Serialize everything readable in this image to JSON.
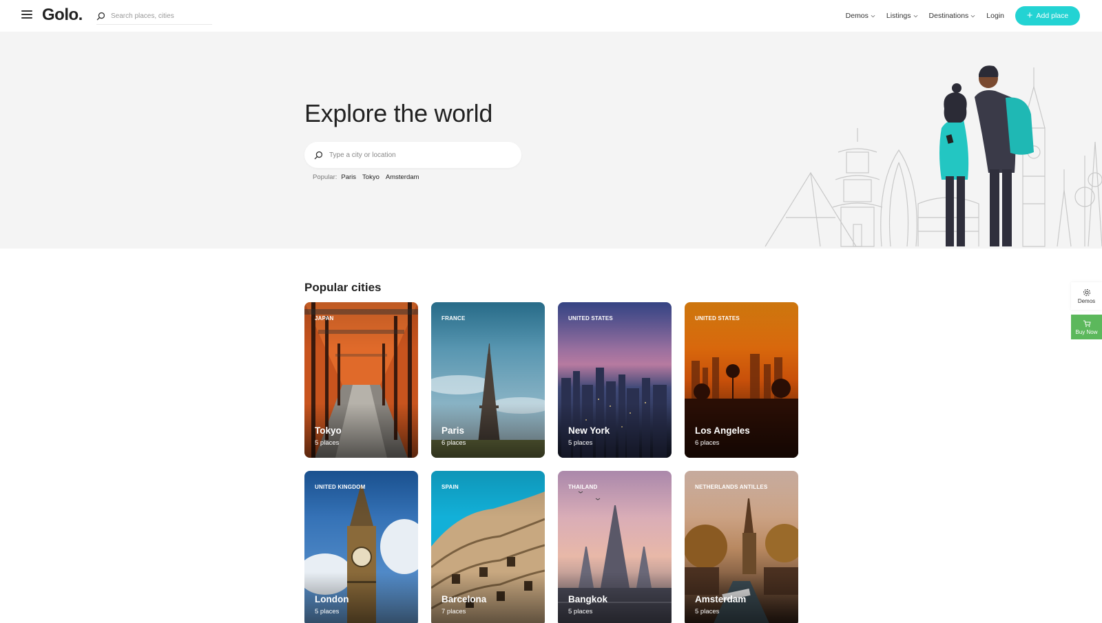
{
  "header": {
    "logo": "Golo.",
    "search_placeholder": "Search places, cities",
    "nav": [
      {
        "label": "Demos"
      },
      {
        "label": "Listings"
      },
      {
        "label": "Destinations"
      }
    ],
    "login": "Login",
    "add_place": "Add place"
  },
  "hero": {
    "title": "Explore the world",
    "search_placeholder": "Type a city or location",
    "popular_label": "Popular:",
    "popular_links": [
      "Paris",
      "Tokyo",
      "Amsterdam"
    ]
  },
  "section": {
    "title": "Popular cities"
  },
  "cities": [
    {
      "country": "Japan",
      "city": "Tokyo",
      "places": "5 places"
    },
    {
      "country": "France",
      "city": "Paris",
      "places": "6 places"
    },
    {
      "country": "United States",
      "city": "New York",
      "places": "5 places"
    },
    {
      "country": "United States",
      "city": "Los Angeles",
      "places": "6 places"
    },
    {
      "country": "United Kingdom",
      "city": "London",
      "places": "5 places"
    },
    {
      "country": "Spain",
      "city": "Barcelona",
      "places": "7 places"
    },
    {
      "country": "Thailand",
      "city": "Bangkok",
      "places": "5 places"
    },
    {
      "country": "Netherlands Antilles",
      "city": "Amsterdam",
      "places": "5 places"
    }
  ],
  "side": {
    "demos": "Demos",
    "buy_now": "Buy Now"
  },
  "colors": {
    "accent": "#23d3d3",
    "buy": "#5cb85c"
  }
}
